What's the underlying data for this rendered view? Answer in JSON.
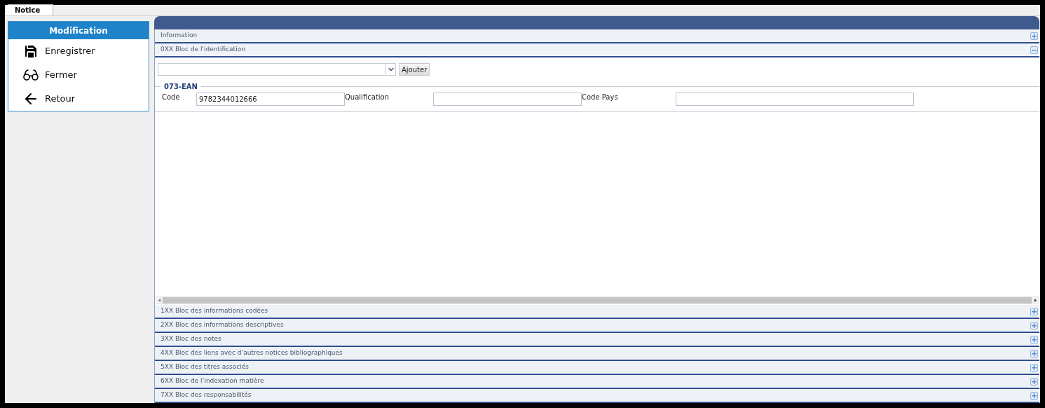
{
  "tabs": [
    {
      "label": "Notice",
      "selected": true
    }
  ],
  "sidebar": {
    "title": "Modification",
    "items": [
      {
        "label": "Enregistrer"
      },
      {
        "label": "Fermer"
      },
      {
        "label": "Retour"
      }
    ]
  },
  "sections": [
    {
      "title": "Information",
      "expanded": false
    },
    {
      "title": "0XX Bloc de l'identification",
      "expanded": true,
      "form": {
        "add_button": "Ajouter",
        "group": {
          "title": "073-EAN",
          "fields": [
            {
              "label": "Code",
              "value": "9782344012666"
            },
            {
              "label": "Qualification"
            },
            {
              "label": "Code Pays"
            }
          ]
        }
      }
    },
    {
      "title": "1XX Bloc des informations codées",
      "expanded": false
    },
    {
      "title": "2XX Bloc des informations descriptives",
      "expanded": false
    },
    {
      "title": "3XX Bloc des notes",
      "expanded": false
    },
    {
      "title": "4XX Bloc des liens avec d’autres notices bibliographiques",
      "expanded": false
    },
    {
      "title": "5XX Bloc des titres associés",
      "expanded": false
    },
    {
      "title": "6XX Bloc de l’indexation matière",
      "expanded": false
    },
    {
      "title": "7XX Bloc des responsabilités",
      "expanded": false
    }
  ]
}
